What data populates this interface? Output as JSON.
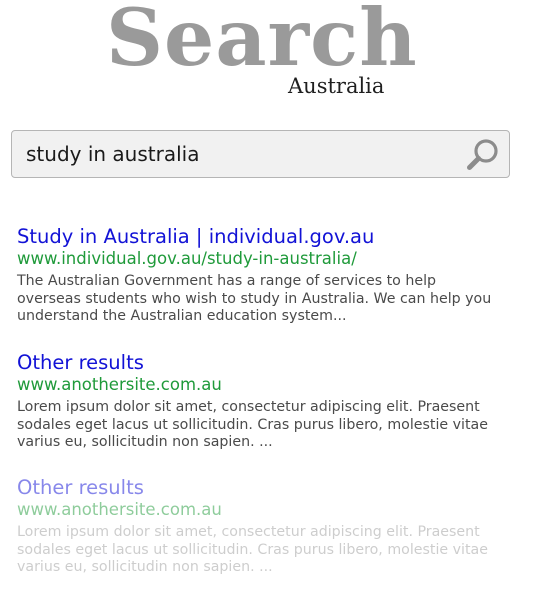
{
  "logo": {
    "word": "Search",
    "sub": "Australia"
  },
  "search": {
    "value": "study in australia",
    "icon": "search-icon"
  },
  "colors": {
    "title_link": "#1212d6",
    "url": "#1f9a3a",
    "snippet": "#4a4a4a",
    "logo": "#9a9a9a",
    "search_box_bg": "#f1f1f1"
  },
  "results": [
    {
      "title": "Study in Australia | individual.gov.au",
      "url": "www.individual.gov.au/study-in-australia/",
      "snippet_lines": [
        "The Australian Government has a range of services to help",
        "overseas students who wish to study in Australia. We can help you",
        "understand the Australian education system..."
      ]
    },
    {
      "title": "Other results",
      "url": "www.anothersite.com.au",
      "snippet_lines": [
        "Lorem ipsum dolor sit amet, consectetur adipiscing elit. Praesent",
        "sodales eget lacus ut sollicitudin. Cras purus libero, molestie vitae",
        "varius eu, sollicitudin non sapien. ..."
      ]
    },
    {
      "title": "Other results",
      "url": "www.anothersite.com.au",
      "snippet_lines": [
        "Lorem ipsum dolor sit amet, consectetur adipiscing elit. Praesent",
        "sodales eget lacus ut sollicitudin. Cras purus libero, molestie vitae",
        "varius eu, sollicitudin non sapien. ..."
      ]
    }
  ]
}
